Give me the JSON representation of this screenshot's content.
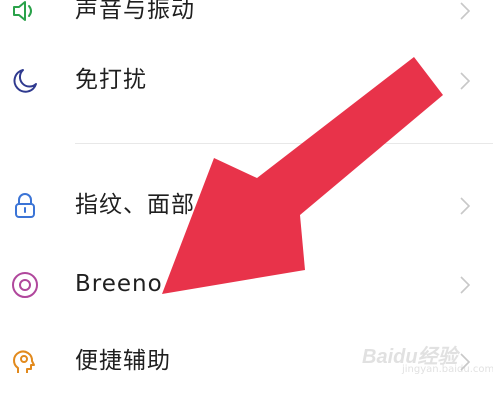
{
  "settings": {
    "items": [
      {
        "label": "声音与振动",
        "icon": "speaker-icon"
      },
      {
        "label": "免打扰",
        "icon": "moon-icon"
      },
      {
        "label": "指纹、面部与密码",
        "icon": "lock-icon"
      },
      {
        "label": "Breeno",
        "icon": "breeno-icon"
      },
      {
        "label": "便捷辅助",
        "icon": "head-bulb-icon"
      }
    ]
  },
  "watermark": {
    "text": "Baidu经验",
    "subtext": "jingyan.baidu.com"
  },
  "colors": {
    "text": "#1f1f1f",
    "chevron": "#c8c8c8",
    "icon_blue": "#2f3a8f",
    "icon_green": "#2aa24a",
    "icon_lightblue": "#3b74d6",
    "icon_purple": "#b0479c",
    "icon_orange": "#e28a1d",
    "arrow": "#e8334a"
  }
}
